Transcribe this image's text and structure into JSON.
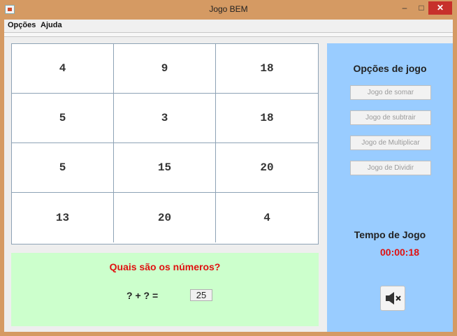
{
  "window": {
    "title": "Jogo BEM"
  },
  "menu": {
    "items": [
      "Opções",
      "Ajuda"
    ]
  },
  "grid": {
    "rows": [
      [
        "4",
        "9",
        "18"
      ],
      [
        "5",
        "3",
        "18"
      ],
      [
        "5",
        "15",
        "20"
      ],
      [
        "13",
        "20",
        "4"
      ]
    ]
  },
  "question": {
    "title": "Quais são os números?",
    "equation": "? + ? =",
    "answer": "25"
  },
  "options": {
    "title": "Opções de jogo",
    "buttons": [
      "Jogo de somar",
      "Jogo de subtrair",
      "Jogo de Multiplicar",
      "Jogo de Dividir"
    ]
  },
  "timer": {
    "title": "Tempo de Jogo",
    "value": "00:00:18"
  },
  "icons": {
    "sound": "speaker-mute-icon"
  },
  "colors": {
    "options_panel": "#99ccff",
    "question_panel": "#ccffcc",
    "question_text": "#e01010",
    "timer_text": "#e01010"
  }
}
